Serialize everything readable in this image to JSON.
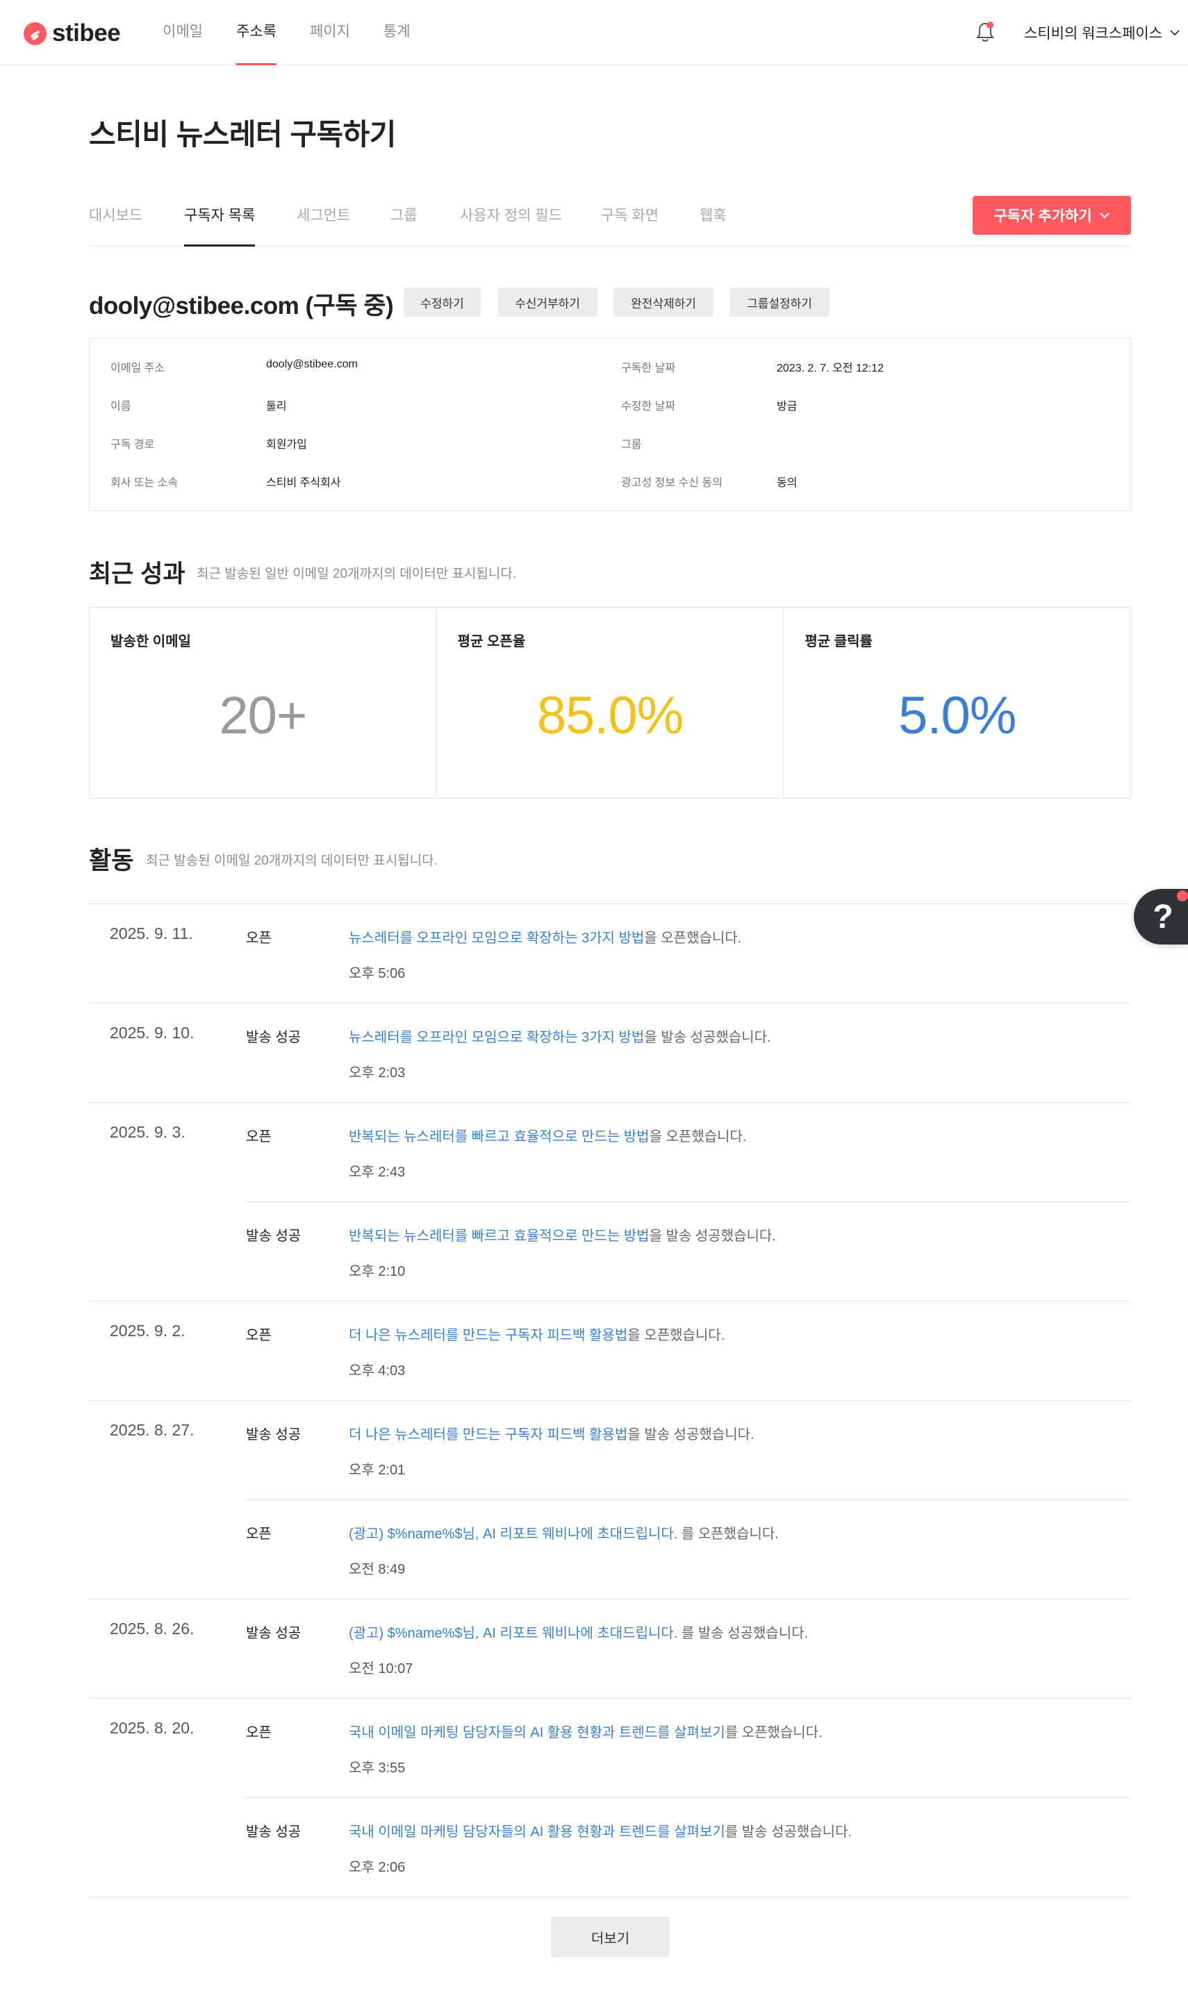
{
  "app": {
    "logo_text": "stibee",
    "brand_color": "#ff5a5f",
    "link_color": "#3a7fd5"
  },
  "topnav": {
    "items": [
      {
        "label": "이메일",
        "active": false
      },
      {
        "label": "주소록",
        "active": true
      },
      {
        "label": "페이지",
        "active": false
      },
      {
        "label": "통계",
        "active": false
      }
    ],
    "workspace": "스티비의 워크스페이스",
    "icons": [
      "bell-icon",
      "chevron-down-icon"
    ]
  },
  "page": {
    "title": "스티비 뉴스레터 구독하기"
  },
  "subtabs": {
    "items": [
      {
        "label": "대시보드"
      },
      {
        "label": "구독자 목록"
      },
      {
        "label": "세그먼트"
      },
      {
        "label": "그룹"
      },
      {
        "label": "사용자 정의 필드"
      },
      {
        "label": "구독 화면"
      },
      {
        "label": "웹훅"
      }
    ],
    "active_index": 1,
    "add_button": "구독자 추가하기"
  },
  "subscriber": {
    "heading": "dooly@stibee.com (구독 중)",
    "actions": [
      "수정하기",
      "수신거부하기",
      "완전삭제하기",
      "그룹설정하기"
    ],
    "fields": [
      {
        "label": "이메일 주소",
        "value": "dooly@stibee.com"
      },
      {
        "label": "이름",
        "value": "둘리"
      },
      {
        "label": "구독 경로",
        "value": "회원가입"
      },
      {
        "label": "회사 또는 소속",
        "value": "스티비 주식회사"
      },
      {
        "label": "구독한 날짜",
        "value": "2023. 2. 7. 오전 12:12"
      },
      {
        "label": "수정한 날짜",
        "value": "방금"
      },
      {
        "label": "그룹",
        "value": ""
      },
      {
        "label": "광고성 정보 수신 동의",
        "value": "동의"
      }
    ]
  },
  "performance": {
    "title": "최근 성과",
    "note": "최근 발송된 일반 이메일 20개까지의 데이터만 표시됩니다.",
    "stats": [
      {
        "label": "발송한 이메일",
        "value": "20+",
        "color": "#999999"
      },
      {
        "label": "평균 오픈율",
        "value": "85.0%",
        "color": "#f5c01a"
      },
      {
        "label": "평균 클릭률",
        "value": "5.0%",
        "color": "#3a7fd5"
      }
    ]
  },
  "activity": {
    "title": "활동",
    "note": "최근 발송된 이메일 20개까지의 데이터만 표시됩니다.",
    "entries": [
      {
        "date": "2025. 9. 11.",
        "type": "오픈",
        "link": "뉴스레터를 오프라인 모임으로 확장하는 3가지 방법",
        "suffix": "을 오픈했습니다.",
        "time": "오후 5:06"
      },
      {
        "date": "2025. 9. 10.",
        "type": "발송 성공",
        "link": "뉴스레터를 오프라인 모임으로 확장하는 3가지 방법",
        "suffix": "을 발송 성공했습니다.",
        "time": "오후 2:03"
      },
      {
        "date": "2025. 9. 3.",
        "type": "오픈",
        "link": "반복되는 뉴스레터를 빠르고 효율적으로 만드는 방법",
        "suffix": "을 오픈했습니다.",
        "time": "오후 2:43"
      },
      {
        "date": "",
        "type": "발송 성공",
        "link": "반복되는 뉴스레터를 빠르고 효율적으로 만드는 방법",
        "suffix": "을 발송 성공했습니다.",
        "time": "오후 2:10"
      },
      {
        "date": "2025. 9. 2.",
        "type": "오픈",
        "link": "더 나은 뉴스레터를 만드는 구독자 피드백 활용법",
        "suffix": "을 오픈했습니다.",
        "time": "오후 4:03"
      },
      {
        "date": "2025. 8. 27.",
        "type": "발송 성공",
        "link": "더 나은 뉴스레터를 만드는 구독자 피드백 활용법",
        "suffix": "을 발송 성공했습니다.",
        "time": "오후 2:01"
      },
      {
        "date": "",
        "type": "오픈",
        "link": "(광고) $%name%$님, AI 리포트 웨비나에 초대드립니다.",
        "suffix": " 를 오픈했습니다.",
        "time": "오전 8:49"
      },
      {
        "date": "2025. 8. 26.",
        "type": "발송 성공",
        "link": "(광고) $%name%$님, AI 리포트 웨비나에 초대드립니다.",
        "suffix": " 를 발송 성공했습니다.",
        "time": "오전 10:07"
      },
      {
        "date": "2025. 8. 20.",
        "type": "오픈",
        "link": "국내 이메일 마케팅 담당자들의 AI 활용 현황과 트렌드를 살펴보기",
        "suffix": "를 오픈했습니다.",
        "time": "오후 3:55"
      },
      {
        "date": "",
        "type": "발송 성공",
        "link": "국내 이메일 마케팅 담당자들의 AI 활용 현황과 트렌드를 살펴보기",
        "suffix": "를 발송 성공했습니다.",
        "time": "오후 2:06"
      }
    ],
    "more_button": "더보기"
  },
  "help": {
    "label": "?"
  }
}
